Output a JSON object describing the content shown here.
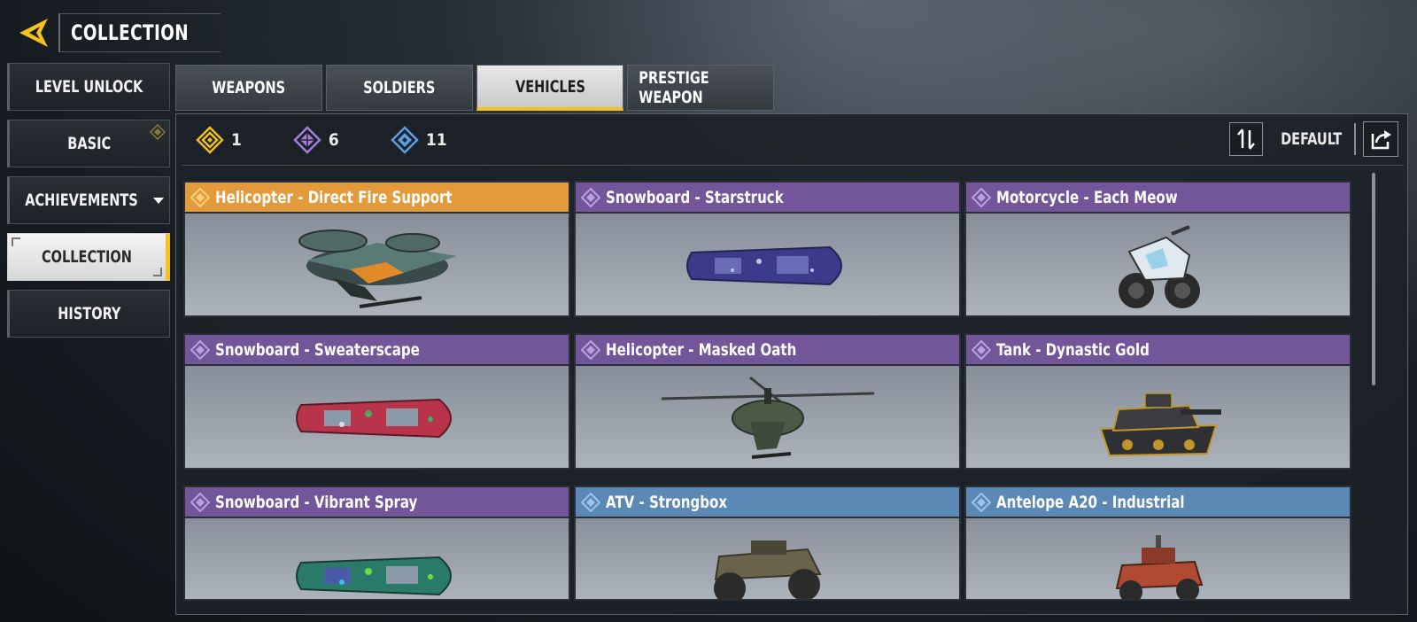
{
  "header": {
    "title": "COLLECTION"
  },
  "sidebar": {
    "items": [
      {
        "label": "LEVEL UNLOCK"
      },
      {
        "label": "BASIC"
      },
      {
        "label": "ACHIEVEMENTS"
      },
      {
        "label": "COLLECTION"
      },
      {
        "label": "HISTORY"
      }
    ]
  },
  "tabs": [
    {
      "label": "WEAPONS"
    },
    {
      "label": "SOLDIERS"
    },
    {
      "label": "VEHICLES"
    },
    {
      "label": "PRESTIGE WEAPON"
    }
  ],
  "counts": {
    "legendary": "1",
    "epic": "6",
    "rare": "11"
  },
  "sort": {
    "label": "DEFAULT"
  },
  "cards": [
    {
      "title": "Helicopter - Direct Fire Support",
      "rarity": "legendary"
    },
    {
      "title": "Snowboard - Starstruck",
      "rarity": "epic"
    },
    {
      "title": "Motorcycle - Each Meow",
      "rarity": "epic"
    },
    {
      "title": "Snowboard - Sweaterscape",
      "rarity": "epic"
    },
    {
      "title": "Helicopter - Masked Oath",
      "rarity": "epic"
    },
    {
      "title": "Tank - Dynastic Gold",
      "rarity": "epic"
    },
    {
      "title": "Snowboard - Vibrant Spray",
      "rarity": "epic"
    },
    {
      "title": "ATV - Strongbox",
      "rarity": "rare"
    },
    {
      "title": "Antelope A20 - Industrial",
      "rarity": "rare"
    }
  ],
  "colors": {
    "legendary": "#e29a3a",
    "epic": "#73559a",
    "rare": "#5c88b5",
    "accent": "#f4c21a"
  }
}
